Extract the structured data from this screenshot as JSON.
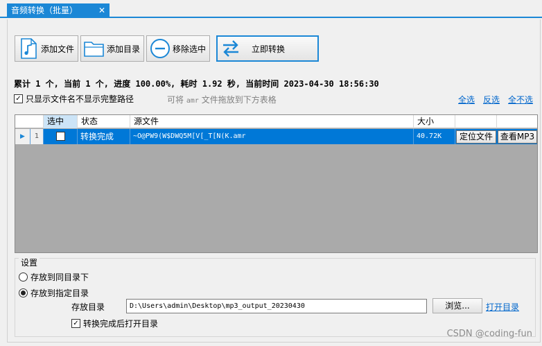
{
  "tab": {
    "title": "音频转换（批量）",
    "close": "✕"
  },
  "toolbar": {
    "add_file": "添加文件",
    "add_dir": "添加目录",
    "remove_selected": "移除选中",
    "convert_now": "立即转换"
  },
  "status_line": "累计 1 个, 当前 1 个, 进度 100.00%, 耗时 1.92 秒, 当前时间 2023-04-30 18:56:30",
  "options": {
    "only_filename_label": "只显示文件名不显示完整路径",
    "only_filename_checked": true,
    "hint_prefix": "可将",
    "hint_mono": "amr",
    "hint_suffix": "文件拖放到下方表格",
    "select_all": "全选",
    "invert": "反选",
    "select_none": "全不选"
  },
  "grid": {
    "headers": {
      "selected": "选中",
      "state": "状态",
      "source": "源文件",
      "size": "大小"
    },
    "rows": [
      {
        "row_arrow": "▶",
        "index": "1",
        "checked": false,
        "state": "转换完成",
        "source": "~O@PW9(W$DWQ5M[V[_T[N(K.amr",
        "size": "40.72K",
        "locate_btn": "定位文件",
        "view_btn": "查看MP3"
      }
    ]
  },
  "settings": {
    "title": "设置",
    "same_dir": "存放到同目录下",
    "same_dir_selected": false,
    "specific_dir": "存放到指定目录",
    "specific_dir_selected": true,
    "dir_label": "存放目录",
    "dir_value": "D:\\Users\\admin\\Desktop\\mp3_output_20230430",
    "browse": "浏览...",
    "open_dir": "打开目录",
    "open_after": "转换完成后打开目录",
    "open_after_checked": true
  },
  "watermark": "CSDN @coding-fun",
  "colors": {
    "accent": "#1b87d6",
    "selection": "#0078d7",
    "link": "#0066cc",
    "grid_bg": "#aaaaaa"
  }
}
